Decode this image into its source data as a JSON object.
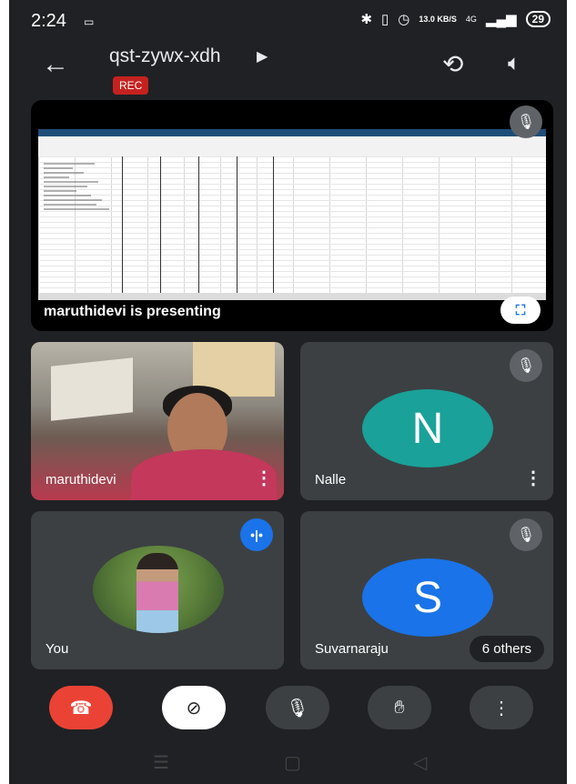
{
  "status_bar": {
    "time": "2:24",
    "network_speed": "13.0 KB/S",
    "signal_label": "4G",
    "battery": "29"
  },
  "app_bar": {
    "meeting_code": "qst-zywx-xdh",
    "rec_badge": "REC"
  },
  "presentation": {
    "label": "maruthidevi is presenting"
  },
  "tiles": [
    {
      "name": "maruthidevi",
      "type": "video"
    },
    {
      "name": "Nalle",
      "type": "avatar",
      "letter": "N",
      "color": "#1aa199"
    },
    {
      "name": "You",
      "type": "photo"
    },
    {
      "name": "Suvarnaraju",
      "type": "avatar",
      "letter": "S",
      "color": "#1a73e8",
      "others": "6 others"
    }
  ],
  "colors": {
    "background": "#202124",
    "tile": "#3c4043",
    "end_call": "#ea4335",
    "rec": "#c5221f",
    "accent": "#1a73e8"
  },
  "controls": [
    {
      "name": "end-call",
      "icon": "phone-hangup-icon"
    },
    {
      "name": "camera-off",
      "icon": "camera-off-icon"
    },
    {
      "name": "microphone",
      "icon": "mic-icon"
    },
    {
      "name": "raise-hand",
      "icon": "hand-icon"
    },
    {
      "name": "more-options",
      "icon": "more-vert-icon"
    }
  ]
}
